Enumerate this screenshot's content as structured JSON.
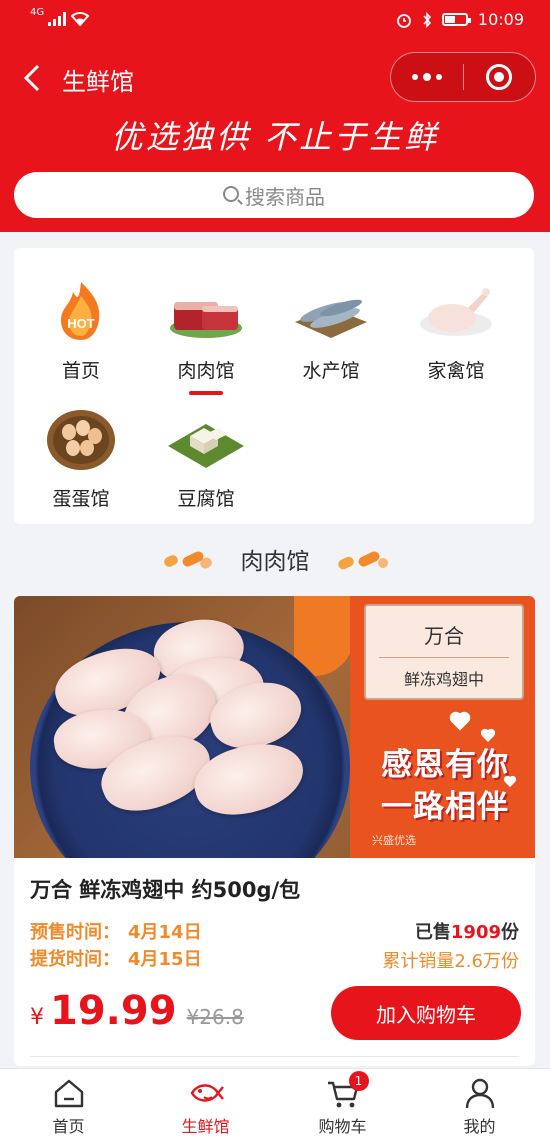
{
  "status_bar": {
    "network": "4G",
    "time": "10:09"
  },
  "nav": {
    "title": "生鲜馆"
  },
  "header": {
    "slogan": "优选独供 不止于生鲜"
  },
  "search": {
    "placeholder": "搜索商品"
  },
  "categories": [
    {
      "label": "首页",
      "icon": "hot-flame-icon",
      "badge_text": "HOT"
    },
    {
      "label": "肉肉馆",
      "icon": "meat-icon",
      "active": true
    },
    {
      "label": "水产馆",
      "icon": "fish-icon"
    },
    {
      "label": "家禽馆",
      "icon": "poultry-icon"
    },
    {
      "label": "蛋蛋馆",
      "icon": "eggs-icon"
    },
    {
      "label": "豆腐馆",
      "icon": "tofu-icon"
    }
  ],
  "section": {
    "title": "肉肉馆"
  },
  "product": {
    "image": {
      "brand": "万合",
      "product_name": "鲜冻鸡翅中",
      "slogan_line1": "感恩有你",
      "slogan_line2": "一路相伴",
      "footer": "兴盛优选"
    },
    "title": "万合 鲜冻鸡翅中 约500g/包",
    "presale_label": "预售时间：",
    "presale_value": "4月14日",
    "pickup_label": "提货时间：",
    "pickup_value": "4月15日",
    "sold_prefix": "已售",
    "sold_count": "1909",
    "sold_suffix": "份",
    "cumulative": "累计销量2.6万份",
    "currency": "¥",
    "price": "19.99",
    "original_price": "¥26.8",
    "cart_button": "加入购物车"
  },
  "tab_bar": {
    "tabs": [
      {
        "label": "首页",
        "icon": "home-icon"
      },
      {
        "label": "生鲜馆",
        "icon": "fish-tab-icon",
        "active": true
      },
      {
        "label": "购物车",
        "icon": "cart-icon",
        "badge": "1"
      },
      {
        "label": "我的",
        "icon": "user-icon"
      }
    ]
  },
  "colors": {
    "primary": "#e8141c",
    "accent_orange": "#f08a2a",
    "background": "#f2f3f7"
  }
}
